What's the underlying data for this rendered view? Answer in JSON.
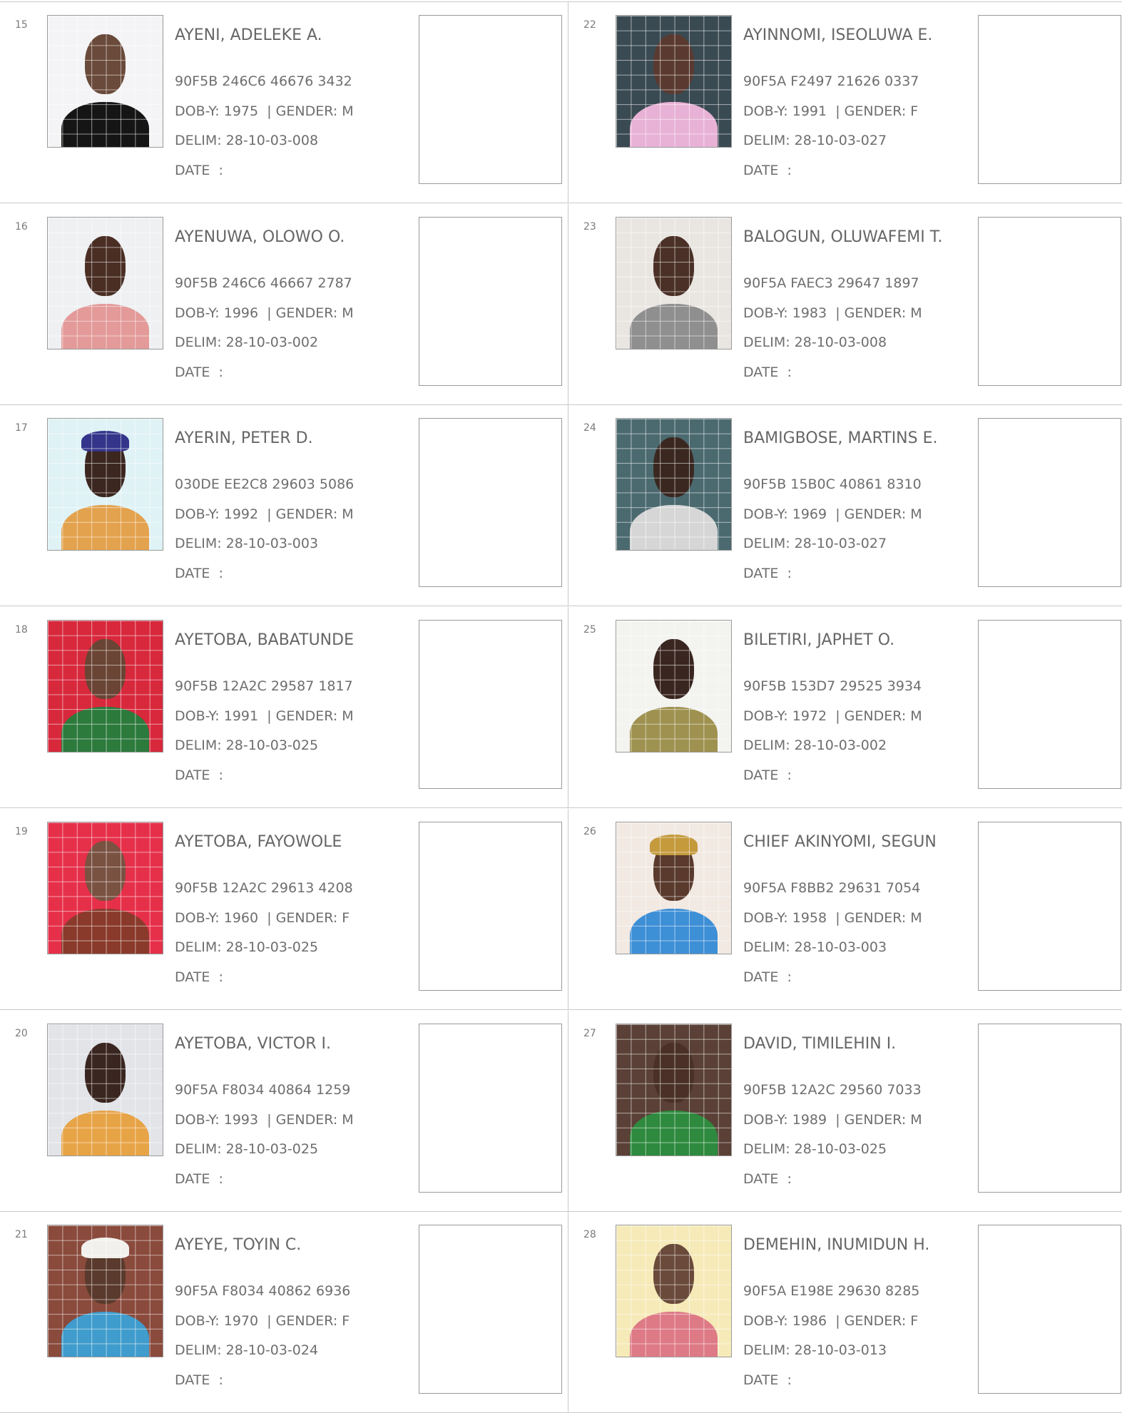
{
  "labels": {
    "dob": "DOB-Y: ",
    "gender_sep": "  | GENDER: ",
    "delim": "DELIM: ",
    "date": "DATE  :"
  },
  "voters": [
    {
      "num": "15",
      "name": "AYENI, ADELEKE A.",
      "vin": "90F5B 246C6 46676 3432",
      "dob": "1975",
      "gender": "M",
      "delim": "28-10-03-008",
      "photo": {
        "bg": "#f4f4f6",
        "clothing": "#151515",
        "skin": "#6a4a3a",
        "cap": ""
      }
    },
    {
      "num": "16",
      "name": "AYENUWA, OLOWO O.",
      "vin": "90F5B 246C6 46667 2787",
      "dob": "1996",
      "gender": "M",
      "delim": "28-10-03-002",
      "photo": {
        "bg": "#eef0f2",
        "clothing": "#e39a98",
        "skin": "#4a2e24",
        "cap": ""
      }
    },
    {
      "num": "17",
      "name": "AYERIN, PETER D.",
      "vin": "030DE EE2C8 29603 5086",
      "dob": "1992",
      "gender": "M",
      "delim": "28-10-03-003",
      "photo": {
        "bg": "#dff2f6",
        "clothing": "#e3a24e",
        "skin": "#3b2620",
        "cap": "#34358a"
      }
    },
    {
      "num": "18",
      "name": "AYETOBA, BABATUNDE",
      "vin": "90F5B 12A2C 29587 1817",
      "dob": "1991",
      "gender": "M",
      "delim": "28-10-03-025",
      "photo": {
        "bg": "#d8283c",
        "clothing": "#2c7a3c",
        "skin": "#6a4434",
        "cap": ""
      }
    },
    {
      "num": "19",
      "name": "AYETOBA, FAYOWOLE",
      "vin": "90F5B 12A2C 29613 4208",
      "dob": "1960",
      "gender": "F",
      "delim": "28-10-03-025",
      "photo": {
        "bg": "#e6304a",
        "clothing": "#8a3a2a",
        "skin": "#7a5242",
        "cap": ""
      }
    },
    {
      "num": "20",
      "name": "AYETOBA, VICTOR I.",
      "vin": "90F5A F8034 40864 1259",
      "dob": "1993",
      "gender": "M",
      "delim": "28-10-03-025",
      "photo": {
        "bg": "#e2e4e8",
        "clothing": "#e7a447",
        "skin": "#3a2620",
        "cap": ""
      }
    },
    {
      "num": "21",
      "name": "AYEYE, TOYIN C.",
      "vin": "90F5A F8034 40862 6936",
      "dob": "1970",
      "gender": "F",
      "delim": "28-10-03-024",
      "photo": {
        "bg": "#8a4a3c",
        "clothing": "#3f9ccd",
        "skin": "#5a3a2c",
        "cap": "#f2f0ec"
      }
    },
    {
      "num": "22",
      "name": "AYINNOMI, ISEOLUWA E.",
      "vin": "90F5A F2497 21626 0337",
      "dob": "1991",
      "gender": "F",
      "delim": "28-10-03-027",
      "photo": {
        "bg": "#3a4a52",
        "clothing": "#e8b2d6",
        "skin": "#5a3a30",
        "cap": ""
      }
    },
    {
      "num": "23",
      "name": "BALOGUN, OLUWAFEMI T.",
      "vin": "90F5A FAEC3 29647 1897",
      "dob": "1983",
      "gender": "M",
      "delim": "28-10-03-008",
      "photo": {
        "bg": "#e9e6e2",
        "clothing": "#8f8f8f",
        "skin": "#4a3026",
        "cap": ""
      }
    },
    {
      "num": "24",
      "name": "BAMIGBOSE, MARTINS E.",
      "vin": "90F5B 15B0C 40861 8310",
      "dob": "1969",
      "gender": "M",
      "delim": "28-10-03-027",
      "photo": {
        "bg": "#4b6a70",
        "clothing": "#d6d6d6",
        "skin": "#3a2820",
        "cap": ""
      }
    },
    {
      "num": "25",
      "name": "BILETIRI, JAPHET O.",
      "vin": "90F5B 153D7 29525 3934",
      "dob": "1972",
      "gender": "M",
      "delim": "28-10-03-002",
      "photo": {
        "bg": "#f3f3f0",
        "clothing": "#9f9250",
        "skin": "#3a2620",
        "cap": ""
      }
    },
    {
      "num": "26",
      "name": "CHIEF AKINYOMI, SEGUN",
      "vin": "90F5A F8BB2 29631 7054",
      "dob": "1958",
      "gender": "M",
      "delim": "28-10-03-003",
      "photo": {
        "bg": "#f1e9e2",
        "clothing": "#3d8fd6",
        "skin": "#5a3a2c",
        "cap": "#c49a3c"
      }
    },
    {
      "num": "27",
      "name": "DAVID, TIMILEHIN I.",
      "vin": "90F5B 12A2C 29560 7033",
      "dob": "1989",
      "gender": "M",
      "delim": "28-10-03-025",
      "photo": {
        "bg": "#5a4036",
        "clothing": "#2e8a3e",
        "skin": "#4a3026",
        "cap": ""
      }
    },
    {
      "num": "28",
      "name": "DEMEHIN, INUMIDUN H.",
      "vin": "90F5A E198E 29630 8285",
      "dob": "1986",
      "gender": "F",
      "delim": "28-10-03-013",
      "photo": {
        "bg": "#f6eab8",
        "clothing": "#de7a86",
        "skin": "#6a4a3a",
        "cap": ""
      }
    }
  ]
}
